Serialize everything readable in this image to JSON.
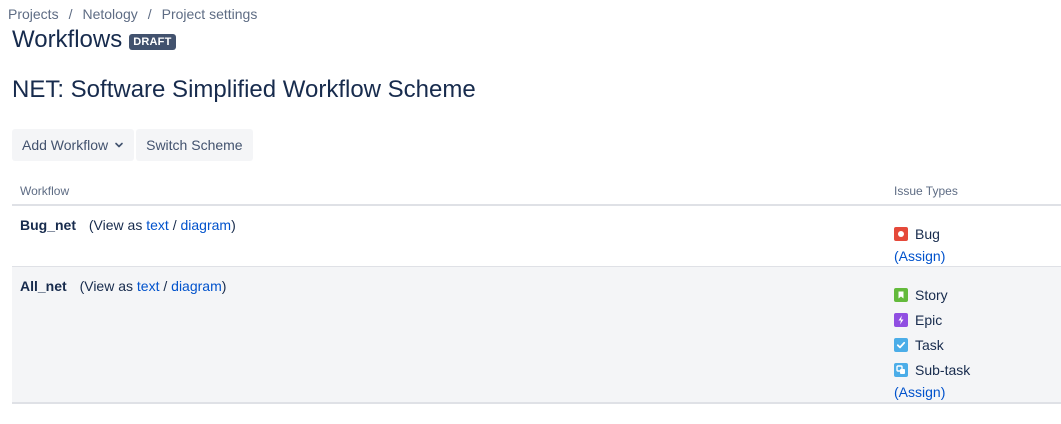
{
  "breadcrumb": {
    "items": [
      "Projects",
      "Netology",
      "Project settings"
    ],
    "separator": "/"
  },
  "header": {
    "title": "Workflows",
    "badge": "DRAFT"
  },
  "scheme": {
    "name": "NET: Software Simplified Workflow Scheme"
  },
  "toolbar": {
    "add_workflow_label": "Add Workflow",
    "switch_scheme_label": "Switch Scheme"
  },
  "table": {
    "headers": {
      "workflow": "Workflow",
      "issue_types": "Issue Types"
    },
    "view_as_prefix": "(View as",
    "text_link": "text",
    "slash": "/",
    "diagram_link": "diagram",
    "close_paren": ")",
    "assign_open": "(",
    "assign_label": "Assign",
    "assign_close": ")",
    "rows": [
      {
        "name": "Bug_net",
        "issue_types": [
          {
            "label": "Bug",
            "icon": "bug-icon",
            "color": "#e5493a"
          }
        ]
      },
      {
        "name": "All_net",
        "issue_types": [
          {
            "label": "Story",
            "icon": "story-icon",
            "color": "#63ba3c"
          },
          {
            "label": "Epic",
            "icon": "epic-icon",
            "color": "#904ee2"
          },
          {
            "label": "Task",
            "icon": "task-icon",
            "color": "#4bade8"
          },
          {
            "label": "Sub-task",
            "icon": "subtask-icon",
            "color": "#4bade8"
          }
        ]
      }
    ]
  }
}
